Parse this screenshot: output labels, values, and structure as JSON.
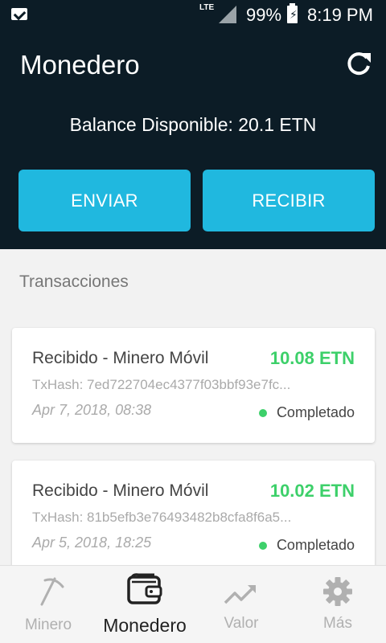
{
  "status_bar": {
    "network": "LTE",
    "battery": "99%",
    "time": "8:19 PM"
  },
  "header": {
    "title": "Monedero",
    "balance": "Balance Disponible: 20.1 ETN",
    "send_label": "ENVIAR",
    "receive_label": "RECIBIR"
  },
  "transactions": {
    "title": "Transacciones",
    "items": [
      {
        "title": "Recibido - Minero Móvil",
        "amount": "10.08 ETN",
        "hash": "TxHash: 7ed722704ec4377f03bbf93e7fc...",
        "date": "Apr 7, 2018, 08:38",
        "status": "Completado"
      },
      {
        "title": "Recibido - Minero Móvil",
        "amount": "10.02 ETN",
        "hash": "TxHash: 81b5efb3e76493482b8cfa8f6a5...",
        "date": "Apr 5, 2018, 18:25",
        "status": "Completado"
      }
    ]
  },
  "nav": [
    {
      "label": "Minero",
      "icon": "pickaxe-icon"
    },
    {
      "label": "Monedero",
      "icon": "wallet-icon"
    },
    {
      "label": "Valor",
      "icon": "trending-up-icon"
    },
    {
      "label": "Más",
      "icon": "gear-icon"
    }
  ],
  "colors": {
    "header_bg": "#0c1c26",
    "accent": "#20b8df",
    "positive": "#3dd06a"
  }
}
